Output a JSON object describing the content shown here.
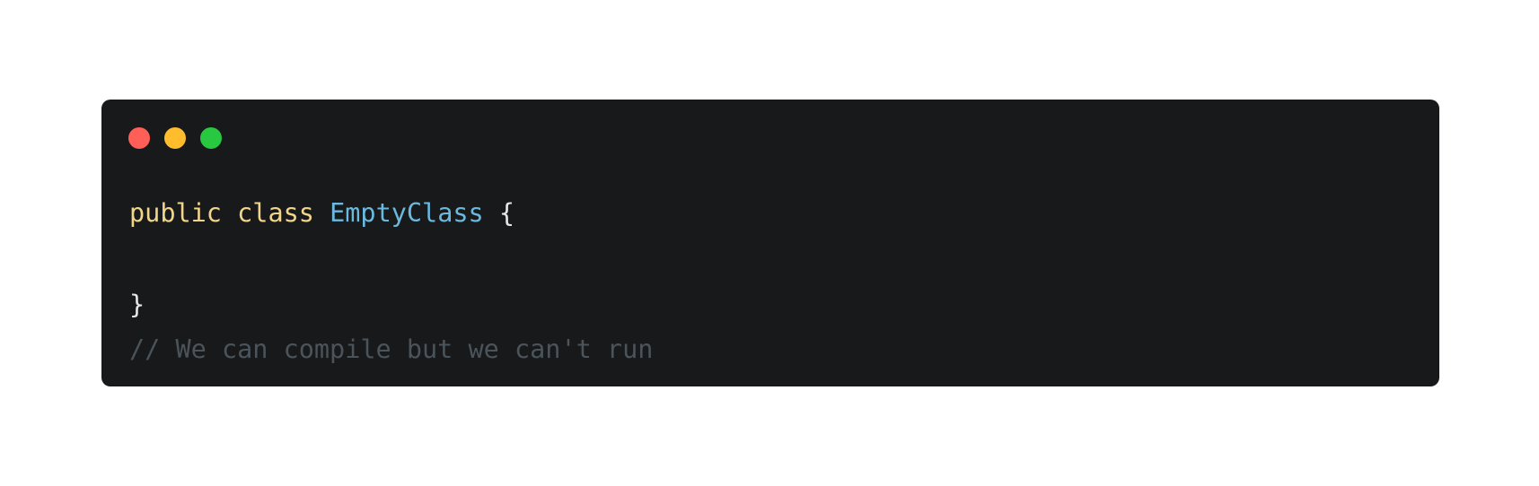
{
  "colors": {
    "page_background": "#ffffff",
    "window_background": "#18191b",
    "close": "#ff5f57",
    "minimize": "#ffbd2e",
    "zoom": "#28c840",
    "keyword": "#f0d58a",
    "class_name": "#6ab9df",
    "punctuation": "#e6e6e6",
    "comment": "#4a545a"
  },
  "window_controls": {
    "close_icon": "close-dot-icon",
    "minimize_icon": "minimize-dot-icon",
    "zoom_icon": "zoom-dot-icon"
  },
  "code": {
    "line1": {
      "keyword_public": "public",
      "keyword_class": "class",
      "class_name": "EmptyClass",
      "open_brace": "{"
    },
    "line3": {
      "close_brace": "}"
    },
    "line4": {
      "comment": "// We can compile but we can't run"
    }
  }
}
